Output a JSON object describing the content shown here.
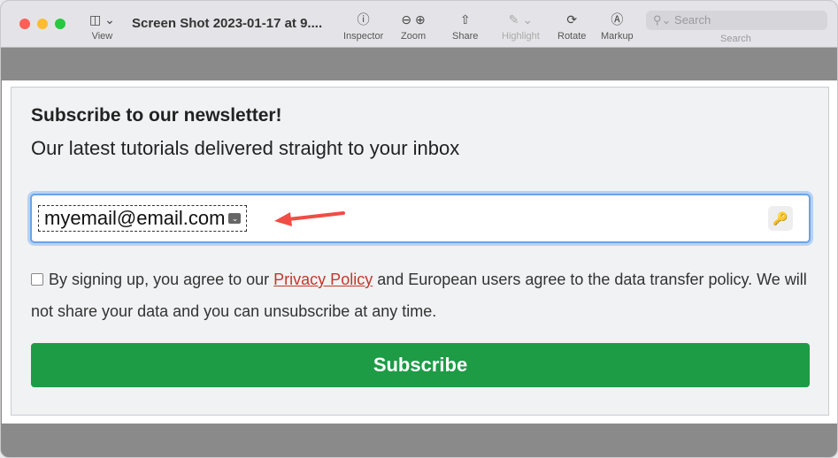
{
  "window": {
    "title": "Screen Shot 2023-01-17 at 9....",
    "colors": {
      "close": "#fe5f57",
      "minimize": "#febc2e",
      "zoom": "#28c840"
    }
  },
  "toolbar": {
    "view": "View",
    "inspector": "Inspector",
    "zoom": "Zoom",
    "share": "Share",
    "highlight": "Highlight",
    "rotate": "Rotate",
    "markup": "Markup",
    "search_placeholder": "Search",
    "search_label": "Search"
  },
  "content": {
    "heading": "Subscribe to our newsletter!",
    "subheading": "Our latest tutorials delivered straight to your inbox",
    "email_value": "myemail@email.com",
    "terms_before": "By signing up, you agree to our ",
    "privacy_link": "Privacy Policy",
    "terms_after": " and European users agree to the data transfer policy. We will not share your data and you can unsubscribe at any time.",
    "subscribe_button": "Subscribe",
    "button_color": "#1d9b45"
  }
}
